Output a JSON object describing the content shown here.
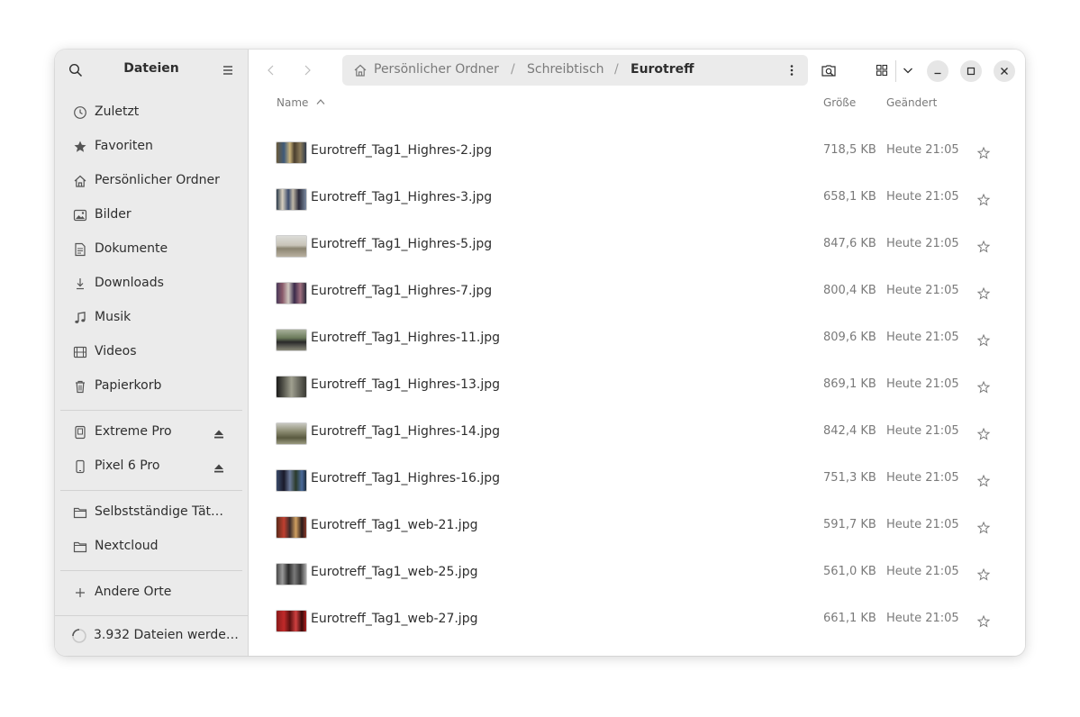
{
  "window": {
    "title": "Dateien"
  },
  "sidebar": {
    "title": "Dateien",
    "places": [
      {
        "label": "Zuletzt",
        "icon": "clock-icon"
      },
      {
        "label": "Favoriten",
        "icon": "star-icon"
      },
      {
        "label": "Persönlicher Ordner",
        "icon": "home-icon"
      },
      {
        "label": "Bilder",
        "icon": "image-icon"
      },
      {
        "label": "Dokumente",
        "icon": "document-icon"
      },
      {
        "label": "Downloads",
        "icon": "download-icon"
      },
      {
        "label": "Musik",
        "icon": "music-icon"
      },
      {
        "label": "Videos",
        "icon": "film-icon"
      },
      {
        "label": "Papierkorb",
        "icon": "trash-icon"
      }
    ],
    "devices": [
      {
        "label": "Extreme Pro",
        "icon": "drive-icon"
      },
      {
        "label": "Pixel 6 Pro",
        "icon": "phone-icon"
      }
    ],
    "bookmarks": [
      {
        "label": "Selbstständige Täti…",
        "icon": "folder-icon"
      },
      {
        "label": "Nextcloud",
        "icon": "folder-icon"
      }
    ],
    "other_locations": "Andere Orte",
    "status": "3.932 Dateien werde…"
  },
  "breadcrumb": {
    "items": [
      "Persönlicher Ordner",
      "Schreibtisch",
      "Eurotreff"
    ],
    "separator": "/"
  },
  "columns": {
    "name": "Name",
    "size": "Größe",
    "modified": "Geändert"
  },
  "files": [
    {
      "name": "Eurotreff_Tag1_Highres-2.jpg",
      "size": "718,5 KB",
      "modified": "Heute 21:05"
    },
    {
      "name": "Eurotreff_Tag1_Highres-3.jpg",
      "size": "658,1 KB",
      "modified": "Heute 21:05"
    },
    {
      "name": "Eurotreff_Tag1_Highres-5.jpg",
      "size": "847,6 KB",
      "modified": "Heute 21:05"
    },
    {
      "name": "Eurotreff_Tag1_Highres-7.jpg",
      "size": "800,4 KB",
      "modified": "Heute 21:05"
    },
    {
      "name": "Eurotreff_Tag1_Highres-11.jpg",
      "size": "809,6 KB",
      "modified": "Heute 21:05"
    },
    {
      "name": "Eurotreff_Tag1_Highres-13.jpg",
      "size": "869,1 KB",
      "modified": "Heute 21:05"
    },
    {
      "name": "Eurotreff_Tag1_Highres-14.jpg",
      "size": "842,4 KB",
      "modified": "Heute 21:05"
    },
    {
      "name": "Eurotreff_Tag1_Highres-16.jpg",
      "size": "751,3 KB",
      "modified": "Heute 21:05"
    },
    {
      "name": "Eurotreff_Tag1_web-21.jpg",
      "size": "591,7 KB",
      "modified": "Heute 21:05"
    },
    {
      "name": "Eurotreff_Tag1_web-25.jpg",
      "size": "561,0 KB",
      "modified": "Heute 21:05"
    },
    {
      "name": "Eurotreff_Tag1_web-27.jpg",
      "size": "661,1 KB",
      "modified": "Heute 21:05"
    }
  ],
  "colors": {
    "sidebar_bg": "#ebebeb",
    "text": "#2e2e2e",
    "muted": "#7a7a7a",
    "pathbar_bg": "#ebebeb"
  }
}
